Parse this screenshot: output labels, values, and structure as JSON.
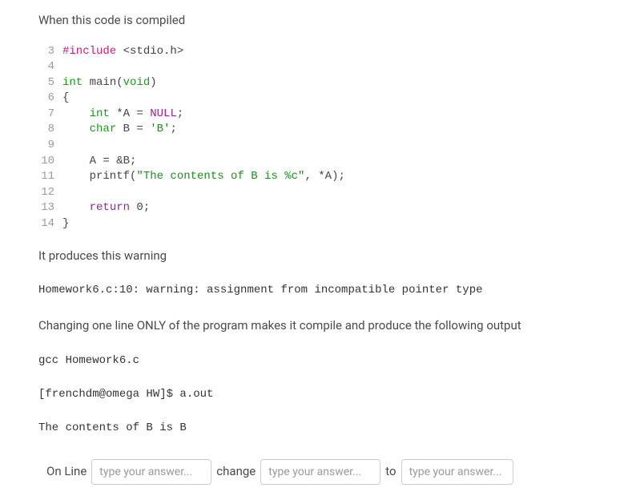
{
  "intro": "When this code is compiled",
  "code": {
    "lines": [
      {
        "num": "3",
        "tokens": [
          {
            "cls": "preproc",
            "t": "#include"
          },
          {
            "cls": "op",
            "t": " <stdio.h>"
          }
        ]
      },
      {
        "num": "4",
        "tokens": []
      },
      {
        "num": "5",
        "tokens": [
          {
            "cls": "type",
            "t": "int"
          },
          {
            "cls": "op",
            "t": " "
          },
          {
            "cls": "ident",
            "t": "main"
          },
          {
            "cls": "op",
            "t": "("
          },
          {
            "cls": "type",
            "t": "void"
          },
          {
            "cls": "op",
            "t": ")"
          }
        ]
      },
      {
        "num": "6",
        "tokens": [
          {
            "cls": "op",
            "t": "{"
          }
        ]
      },
      {
        "num": "7",
        "tokens": [
          {
            "cls": "op",
            "t": "    "
          },
          {
            "cls": "type",
            "t": "int"
          },
          {
            "cls": "op",
            "t": " *A = "
          },
          {
            "cls": "null-kw",
            "t": "NULL"
          },
          {
            "cls": "op",
            "t": ";"
          }
        ]
      },
      {
        "num": "8",
        "tokens": [
          {
            "cls": "op",
            "t": "    "
          },
          {
            "cls": "type",
            "t": "char"
          },
          {
            "cls": "op",
            "t": " B = "
          },
          {
            "cls": "char-lit",
            "t": "'B'"
          },
          {
            "cls": "op",
            "t": ";"
          }
        ]
      },
      {
        "num": "9",
        "tokens": []
      },
      {
        "num": "10",
        "tokens": [
          {
            "cls": "op",
            "t": "    A = &B;"
          }
        ]
      },
      {
        "num": "11",
        "tokens": [
          {
            "cls": "op",
            "t": "    printf("
          },
          {
            "cls": "string",
            "t": "\"The contents of B is %c\""
          },
          {
            "cls": "op",
            "t": ", *A);"
          }
        ]
      },
      {
        "num": "12",
        "tokens": []
      },
      {
        "num": "13",
        "tokens": [
          {
            "cls": "op",
            "t": "    "
          },
          {
            "cls": "keyword",
            "t": "return"
          },
          {
            "cls": "op",
            "t": " 0;"
          }
        ]
      },
      {
        "num": "14",
        "tokens": [
          {
            "cls": "op",
            "t": "}"
          }
        ]
      }
    ]
  },
  "warning_intro": "It produces this warning",
  "warning_text": "Homework6.c:10: warning: assignment from incompatible pointer type",
  "change_intro": "Changing one line ONLY of the program makes it compile and produce the following output",
  "output_block": "gcc Homework6.c\n\n[frenchdm@omega HW]$ a.out\n\nThe contents of B is B",
  "answer": {
    "label_online": "On Line",
    "label_change": "change",
    "label_to": "to",
    "placeholder1": "type your answer...",
    "placeholder2": "type your answer...",
    "placeholder3": "type your answer..."
  }
}
